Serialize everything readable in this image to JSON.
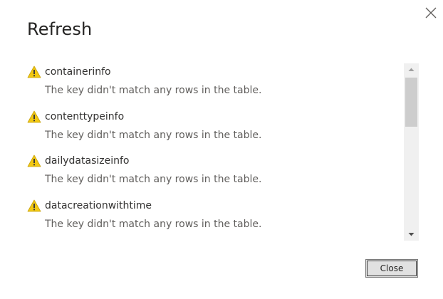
{
  "dialog": {
    "title": "Refresh",
    "close_icon": "close-x-icon",
    "close_button_label": "Close"
  },
  "errors": [
    {
      "name": "containerinfo",
      "message": "The key didn't match any rows in the table.",
      "icon": "warning-icon"
    },
    {
      "name": "contenttypeinfo",
      "message": "The key didn't match any rows in the table.",
      "icon": "warning-icon"
    },
    {
      "name": "dailydatasizeinfo",
      "message": "The key didn't match any rows in the table.",
      "icon": "warning-icon"
    },
    {
      "name": "datacreationwithtime",
      "message": "The key didn't match any rows in the table.",
      "icon": "warning-icon"
    }
  ],
  "colors": {
    "warning_fill": "#f2c811",
    "warning_mark": "#3b3a39",
    "title_text": "#252423",
    "secondary_text": "#605e5c",
    "scrollbar_track": "#f0f0f0",
    "scrollbar_thumb": "#cdcdcd"
  }
}
